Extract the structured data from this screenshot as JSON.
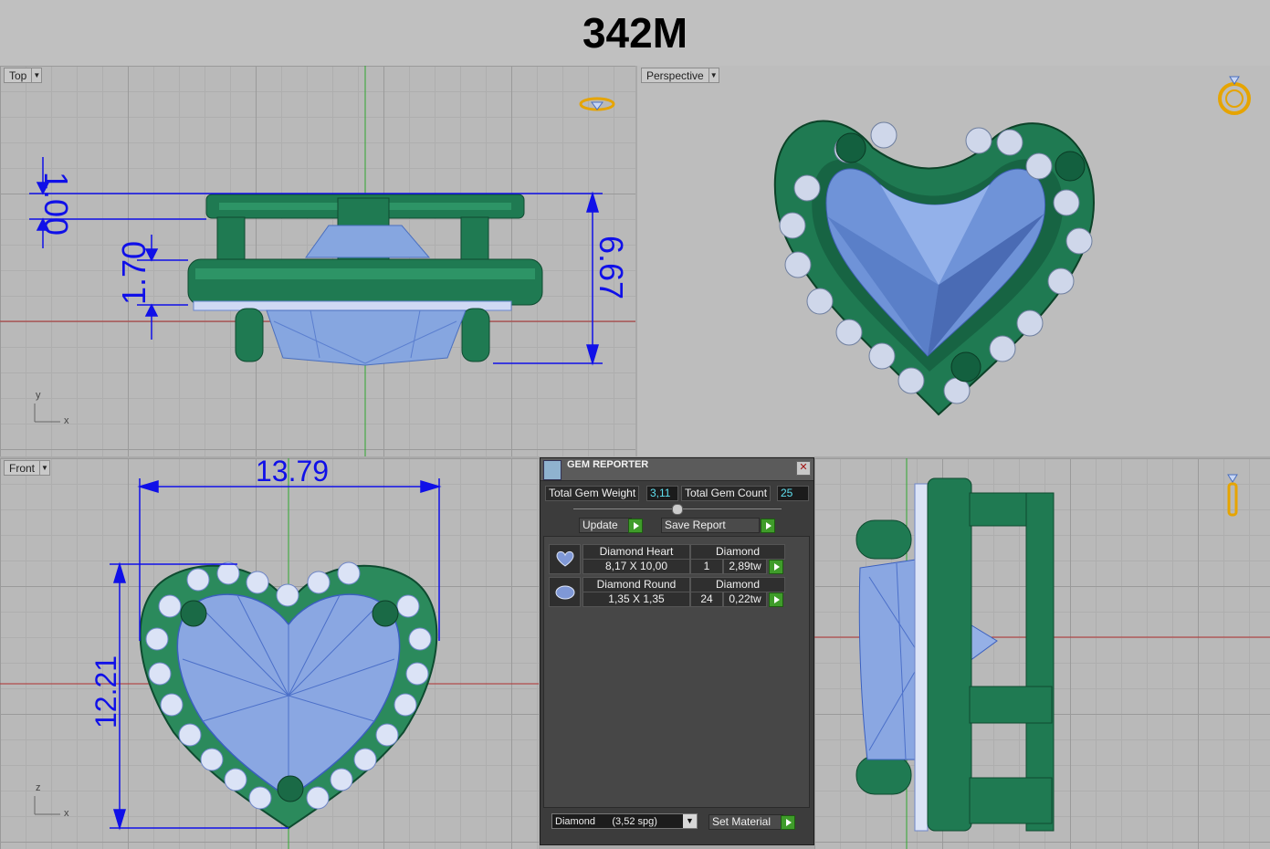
{
  "title": "342M",
  "viewports": {
    "top": {
      "label": "Top",
      "dims": {
        "a": "1.00",
        "b": "1.70",
        "c": "6.67"
      },
      "axis_y": "y",
      "axis_x": "x"
    },
    "perspective": {
      "label": "Perspective"
    },
    "front": {
      "label": "Front",
      "dims": {
        "width": "13.79",
        "height": "12.21"
      },
      "axis_z": "z",
      "axis_x": "x"
    },
    "right": {
      "label": ""
    }
  },
  "gem_reporter": {
    "title": "GEM REPORTER",
    "close": "✕",
    "total_weight_label": "Total Gem Weight",
    "total_weight": "3,11",
    "total_count_label": "Total Gem Count",
    "total_count": "25",
    "update_label": "Update",
    "save_report_label": "Save Report",
    "rows": [
      {
        "name": "Diamond Heart",
        "material": "Diamond",
        "size": "8,17 X 10,00",
        "count": "1",
        "weight": "2,89tw"
      },
      {
        "name": "Diamond Round",
        "material": "Diamond",
        "size": "1,35 X 1,35",
        "count": "24",
        "weight": "0,22tw"
      }
    ],
    "material_select": "Diamond      (3,52 spg)",
    "set_material_label": "Set Material"
  },
  "colors": {
    "metal": "#1f7a52",
    "gem": "#86a6e0",
    "dimension": "#1010e8",
    "grid": "#9a9a9a"
  },
  "icons": [
    "ring-icon",
    "ring-top-icon",
    "ring-side-icon",
    "gem-reporter-icon",
    "heart-gem-icon",
    "round-gem-icon"
  ]
}
